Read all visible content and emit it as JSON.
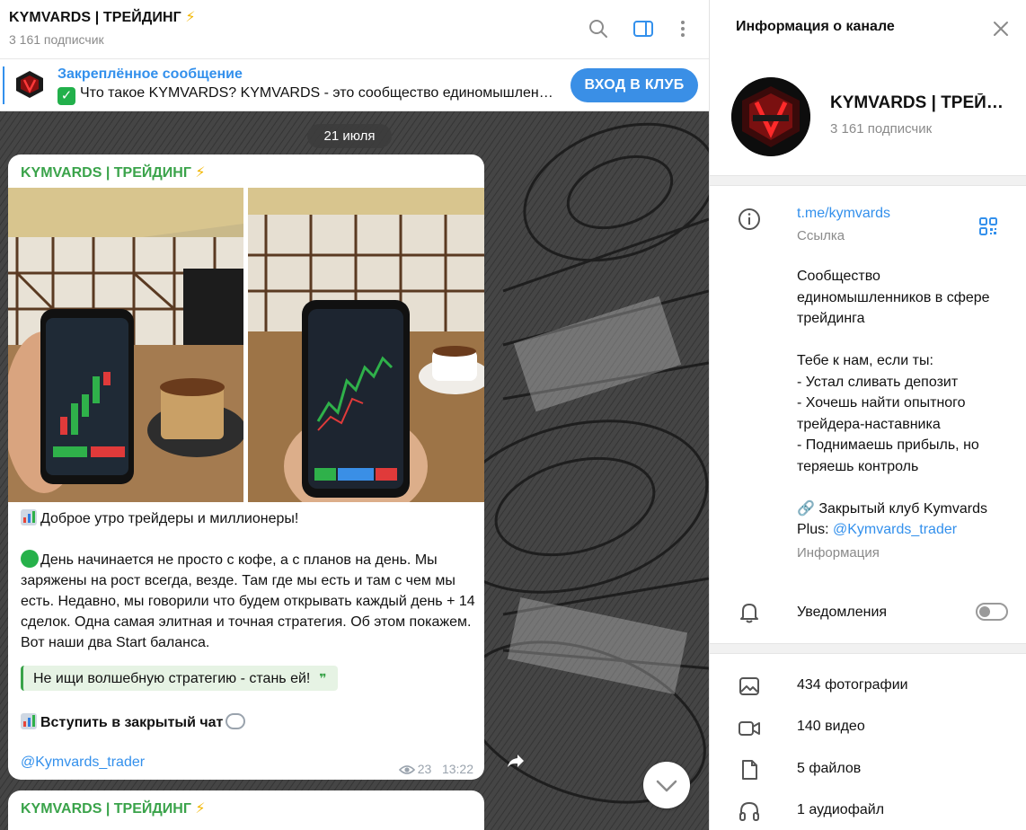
{
  "channel": {
    "title": "KYMVARDS | ТРЕЙДИНГ",
    "subscribers": "3 161 подписчик"
  },
  "topbar": {
    "icons": [
      "search-icon",
      "sidebar-toggle-icon",
      "more-vertical-icon"
    ]
  },
  "pinned": {
    "label": "Закреплённое сообщение",
    "text": "Что такое KYMVARDS?  KYMVARDS - это сообщество единомышленников в сфере трейдинга",
    "button": "ВХОД В КЛУБ"
  },
  "chat": {
    "date": "21 июля",
    "message": {
      "author": "KYMVARDS | ТРЕЙДИНГ",
      "line1": "Доброе утро трейдеры и миллионеры!",
      "paragraph": "День начинается не просто с кофе, а с планов на день. Мы заряжены на рост всегда, везде. Там где мы есть и там с чем мы есть. Недавно, мы говорили что будем открывать каждый день + 14 сделок. Одна самая элитная и точная стратегия. Об этом покажем. Вот наши два Start баланса.",
      "quote": "Не ищи волшебную стратегию - стань ей!",
      "join": "Вступить в закрытый чат",
      "mention": "@Kymvards_trader",
      "views": "23",
      "time": "13:22"
    },
    "next_author": "KYMVARDS | ТРЕЙДИНГ"
  },
  "panel": {
    "header": "Информация о канале",
    "name": "KYMVARDS | ТРЕЙДИНГ",
    "subscribers": "3 161 подписчик",
    "link": "t.me/kymvards",
    "link_caption": "Ссылка",
    "desc_lines": [
      "Сообщество",
      "единомышленников в сфере",
      "трейдинга",
      "",
      "Тебе к нам, если ты:",
      "- Устал сливать депозит",
      "- Хочешь найти опытного",
      "трейдера-наставника",
      "- Поднимаешь прибыль, но",
      "теряешь контроль",
      ""
    ],
    "club_line1": "🔗 Закрытый клуб Kymvards",
    "club_line2_prefix": "Plus: ",
    "club_mention": "@Kymvards_trader",
    "info_caption": "Информация",
    "notifications": "Уведомления",
    "notifications_enabled": false,
    "media": [
      {
        "label": "434 фотографии",
        "icon": "photo-icon"
      },
      {
        "label": "140 видео",
        "icon": "video-icon"
      },
      {
        "label": "5 файлов",
        "icon": "file-icon"
      },
      {
        "label": "1 аудиофайл",
        "icon": "headphones-icon"
      }
    ]
  }
}
